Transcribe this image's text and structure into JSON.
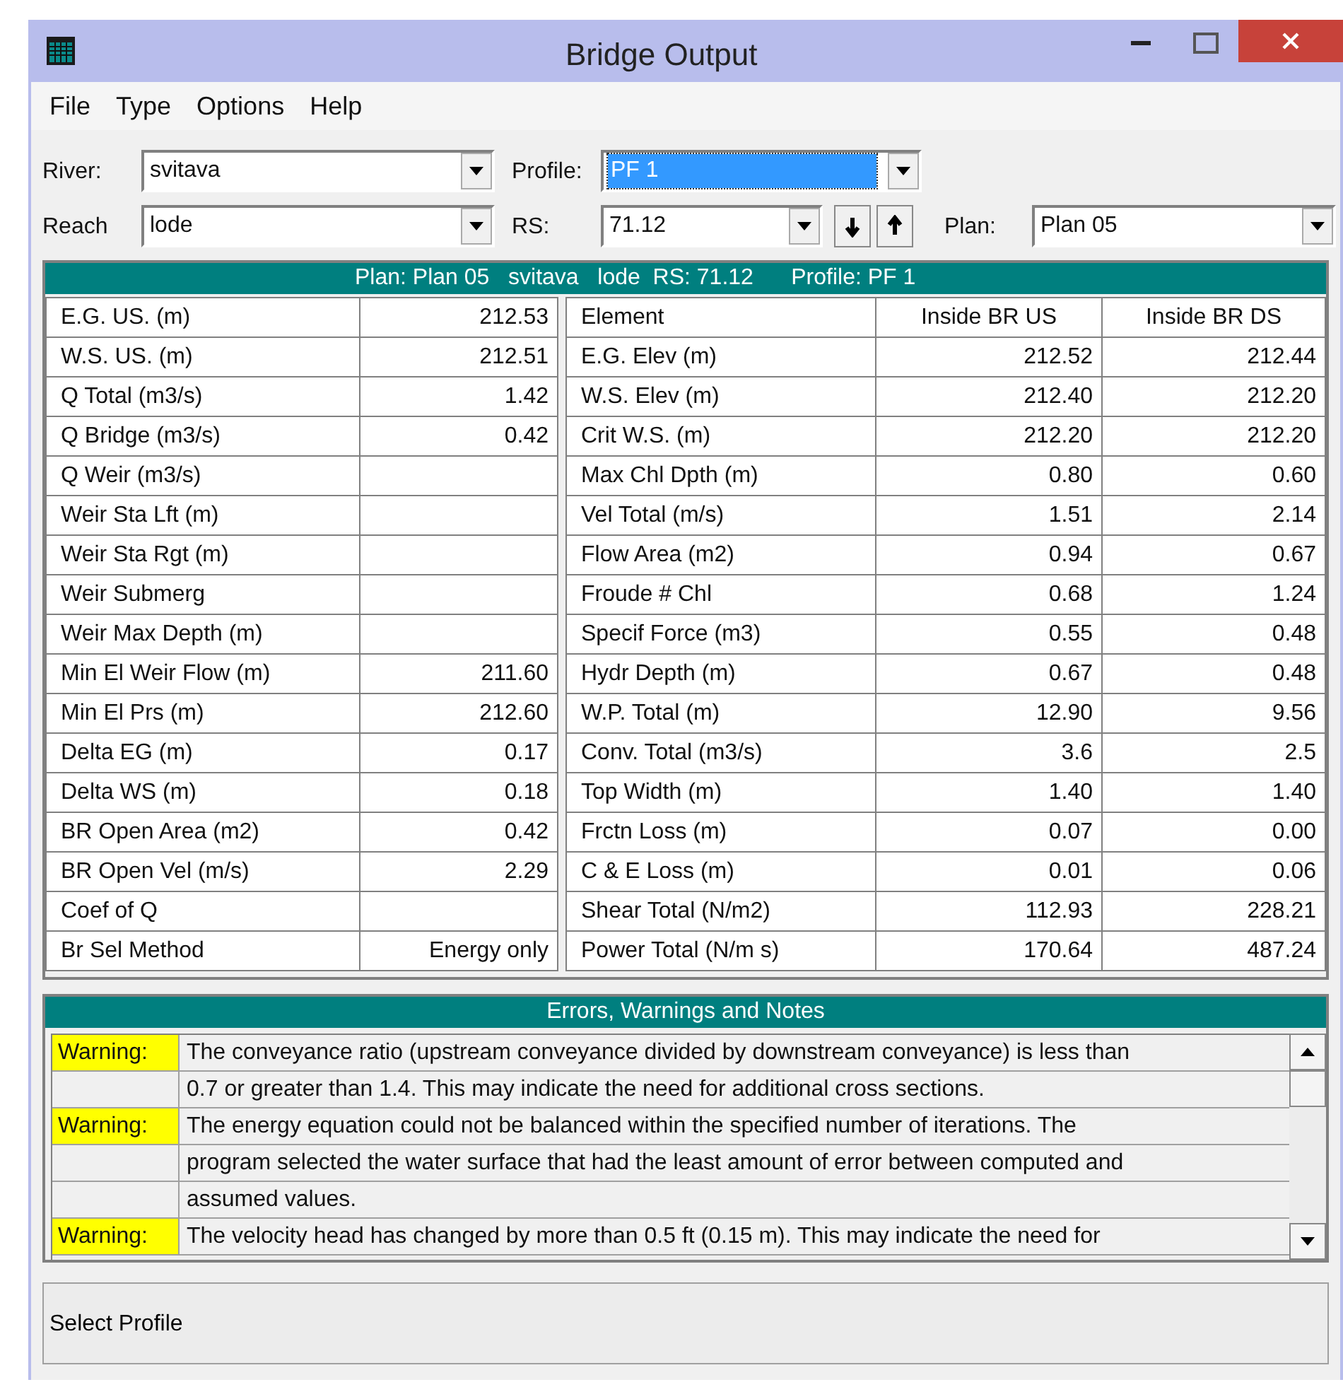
{
  "window": {
    "title": "Bridge Output"
  },
  "menu": [
    "File",
    "Type",
    "Options",
    "Help"
  ],
  "selectors": [
    {
      "label": "River:",
      "value": "svitava",
      "selected": false
    },
    {
      "label": "Profile:",
      "value": "PF 1",
      "selected": true
    },
    {
      "label": "Reach",
      "value": "lode",
      "selected": false
    },
    {
      "label": "RS:",
      "value": "71.12",
      "selected": false
    },
    {
      "label": "Plan:",
      "value": "Plan 05",
      "selected": false
    }
  ],
  "table_header": "Plan: Plan 05   svitava   lode  RS: 71.12      Profile: PF 1",
  "left_table": [
    {
      "label": "E.G. US. (m)",
      "value": "212.53"
    },
    {
      "label": "W.S. US. (m)",
      "value": "212.51"
    },
    {
      "label": "Q Total (m3/s)",
      "value": "1.42"
    },
    {
      "label": "Q Bridge (m3/s)",
      "value": "0.42"
    },
    {
      "label": "Q Weir (m3/s)"
    },
    {
      "label": "Weir Sta Lft (m)"
    },
    {
      "label": "Weir Sta Rgt (m)"
    },
    {
      "label": "Weir Submerg"
    },
    {
      "label": "Weir Max Depth (m)"
    },
    {
      "label": "Min El Weir Flow (m)",
      "value": "211.60"
    },
    {
      "label": "Min El Prs (m)",
      "value": "212.60"
    },
    {
      "label": "Delta EG (m)",
      "value": "0.17"
    },
    {
      "label": "Delta WS (m)",
      "value": "0.18"
    },
    {
      "label": "BR Open Area (m2)",
      "value": "0.42"
    },
    {
      "label": "BR Open Vel (m/s)",
      "value": "2.29"
    },
    {
      "label": "Coef of Q"
    },
    {
      "label": "Br Sel Method",
      "value": "Energy only"
    }
  ],
  "right_table": {
    "columns": [
      "Element",
      "Inside BR US",
      "Inside BR DS"
    ],
    "rows": [
      [
        "E.G. Elev (m)",
        "212.52",
        "212.44"
      ],
      [
        "W.S. Elev (m)",
        "212.40",
        "212.20"
      ],
      [
        "Crit W.S. (m)",
        "212.20",
        "212.20"
      ],
      [
        "Max Chl Dpth (m)",
        "0.80",
        "0.60"
      ],
      [
        "Vel Total (m/s)",
        "1.51",
        "2.14"
      ],
      [
        "Flow Area (m2)",
        "0.94",
        "0.67"
      ],
      [
        "Froude # Chl",
        "0.68",
        "1.24"
      ],
      [
        "Specif Force (m3)",
        "0.55",
        "0.48"
      ],
      [
        "Hydr Depth (m)",
        "0.67",
        "0.48"
      ],
      [
        "W.P. Total (m)",
        "12.90",
        "9.56"
      ],
      [
        "Conv. Total (m3/s)",
        "3.6",
        "2.5"
      ],
      [
        "Top Width (m)",
        "1.40",
        "1.40"
      ],
      [
        "Frctn Loss (m)",
        "0.07",
        "0.00"
      ],
      [
        "C & E Loss (m)",
        "0.01",
        "0.06"
      ],
      [
        "Shear Total (N/m2)",
        "112.93",
        "228.21"
      ],
      [
        "Power Total (N/m s)",
        "170.64",
        "487.24"
      ]
    ]
  },
  "notes": {
    "title": "Errors, Warnings and Notes",
    "messages": [
      {
        "label": "Warning:",
        "lines": [
          "The conveyance ratio (upstream conveyance divided by downstream conveyance) is less than",
          "0.7 or greater than 1.4.  This may indicate the need for additional cross sections."
        ]
      },
      {
        "label": "Warning:",
        "lines": [
          "The energy equation could not be balanced within the specified number of iterations.  The",
          "program selected the water surface that had the least amount of error between computed and",
          "assumed values."
        ]
      },
      {
        "label": "Warning:",
        "lines": [
          "The velocity head has changed by more than 0.5 ft (0.15 m).  This may indicate the need for"
        ]
      }
    ]
  },
  "status_bar": "Select Profile"
}
